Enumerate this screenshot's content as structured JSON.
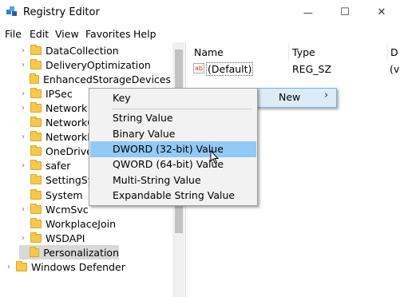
{
  "window": {
    "title": "Registry Editor",
    "minimize_glyph": "—",
    "maximize_glyph": "☐",
    "close_glyph": "✕"
  },
  "menubar": [
    "File",
    "Edit",
    "View",
    "Favorites",
    "Help"
  ],
  "tree": {
    "items": [
      {
        "label": "DataCollection",
        "expandable": true
      },
      {
        "label": "DeliveryOptimization",
        "expandable": true
      },
      {
        "label": "EnhancedStorageDevices",
        "expandable": false
      },
      {
        "label": "IPSec",
        "expandable": true
      },
      {
        "label": "Network",
        "expandable": true
      },
      {
        "label": "NetworkC",
        "expandable": false
      },
      {
        "label": "NetworkP",
        "expandable": true
      },
      {
        "label": "OneDrive",
        "expandable": false
      },
      {
        "label": "safer",
        "expandable": true
      },
      {
        "label": "SettingSy",
        "expandable": false
      },
      {
        "label": "System",
        "expandable": false
      },
      {
        "label": "WcmSvc",
        "expandable": true
      },
      {
        "label": "WorkplaceJoin",
        "expandable": false
      },
      {
        "label": "WSDAPI",
        "expandable": true
      },
      {
        "label": "Personalization",
        "expandable": false,
        "selected": true
      }
    ],
    "parent_item": {
      "label": "Windows Defender",
      "expandable": true
    }
  },
  "list": {
    "columns": [
      "Name",
      "Type",
      "D"
    ],
    "rows": [
      {
        "name": "(Default)",
        "type": "REG_SZ",
        "data": "(v"
      }
    ],
    "value_icon_text": "ab"
  },
  "context_menu": {
    "new_label": "New",
    "arrow": "›",
    "submenu": [
      "Key",
      "String Value",
      "Binary Value",
      "DWORD (32-bit) Value",
      "QWORD (64-bit) Value",
      "Multi-String Value",
      "Expandable String Value"
    ],
    "highlighted": "DWORD (32-bit) Value"
  },
  "colors": {
    "highlight": "#91c9f7",
    "folder": "#f6c84c",
    "menu_bg": "#f2f2f2"
  }
}
